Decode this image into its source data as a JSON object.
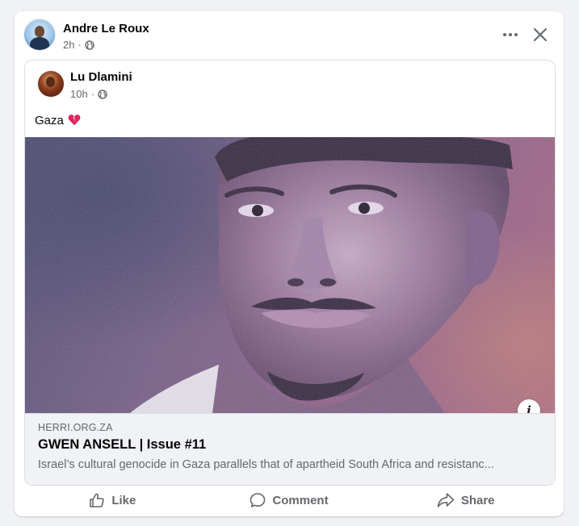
{
  "post": {
    "author": "Andre Le Roux",
    "time": "2h",
    "separator": "·"
  },
  "shared": {
    "author": "Lu Dlamini",
    "time": "10h",
    "separator": "·",
    "text": "Gaza",
    "emoji": "💔"
  },
  "link": {
    "domain": "HERRI.ORG.ZA",
    "title": "GWEN ANSELL | Issue #11",
    "description": "Israel’s cultural genocide in Gaza parallels that of apartheid South Africa and resistanc..."
  },
  "info_glyph": "i",
  "actions": {
    "like": "Like",
    "comment": "Comment",
    "share": "Share"
  },
  "icons": {
    "audience": "globe-icon",
    "more": "more-options-icon",
    "close": "close-icon",
    "info": "info-icon",
    "like": "thumbs-up-icon",
    "comment": "comment-bubble-icon",
    "share": "share-arrow-icon"
  },
  "colors": {
    "background": "#f0f2f5",
    "card": "#ffffff",
    "primary_text": "#050505",
    "secondary_text": "#65676b",
    "border": "#dadde1"
  }
}
